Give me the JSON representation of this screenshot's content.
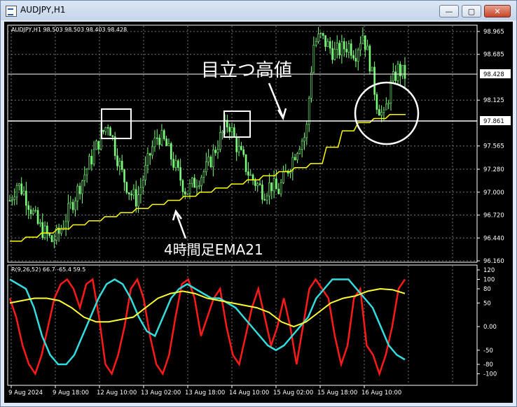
{
  "window": {
    "title": "AUDJPY,H1",
    "minimize_glyph": "—",
    "restore_glyph": "▢",
    "close_glyph": "✕"
  },
  "chart": {
    "info_line": "AUDJPY,H1  98.503 98.503 98.403 98.428",
    "annotation_high": "目立つ高値",
    "annotation_ema": "4時間足EMA21",
    "price_labels": [
      "98.965",
      "98.685",
      "98.125",
      "97.565",
      "97.280",
      "97.000",
      "96.720",
      "96.440",
      "96.160"
    ],
    "current_price": "98.428",
    "line_price": "97.861",
    "indicator_label": "R(9,26,52) 66.7 -65.4 59.5",
    "indicator_levels": [
      "120",
      "100",
      "80",
      "50",
      "0.00",
      "-50",
      "-80",
      "-100"
    ],
    "time_labels": [
      "9 Aug 2024",
      "9 Aug 18:00",
      "12 Aug 10:00",
      "13 Aug 02:00",
      "13 Aug 18:00",
      "14 Aug 10:00",
      "15 Aug 02:00",
      "15 Aug 18:00",
      "16 Aug 10:00"
    ],
    "colors": {
      "candle": "#7CFC7C",
      "ema": "#ffff00",
      "red": "#ff1a1a",
      "cyan": "#33dddd",
      "yellow": "#ffff33"
    }
  },
  "chart_data": {
    "type": "line",
    "title": "AUDJPY,H1",
    "ylim": [
      96.16,
      99.0
    ],
    "price_series": [
      96.9,
      97.1,
      97.0,
      96.8,
      96.6,
      96.5,
      96.4,
      96.5,
      96.7,
      96.9,
      97.1,
      97.3,
      97.5,
      97.7,
      97.86,
      97.5,
      97.2,
      97.0,
      96.9,
      97.2,
      97.5,
      97.7,
      97.6,
      97.4,
      97.2,
      97.0,
      97.1,
      97.2,
      97.3,
      97.5,
      97.7,
      97.86,
      97.6,
      97.4,
      97.2,
      97.1,
      97.0,
      97.1,
      97.0,
      97.2,
      97.4,
      97.6,
      97.7,
      98.8,
      98.9,
      98.8,
      98.7,
      98.75,
      98.8,
      98.7,
      98.95,
      98.6,
      98.1,
      97.9,
      98.3,
      98.5,
      98.43
    ],
    "ema_series": [
      96.4,
      96.45,
      96.5,
      96.55,
      96.6,
      96.65,
      96.7,
      96.75,
      96.8,
      96.85,
      96.9,
      96.95,
      97.0,
      97.05,
      97.1,
      97.15,
      97.2,
      97.25,
      97.3,
      97.35,
      97.55,
      97.75,
      97.85,
      97.9,
      97.95
    ]
  }
}
